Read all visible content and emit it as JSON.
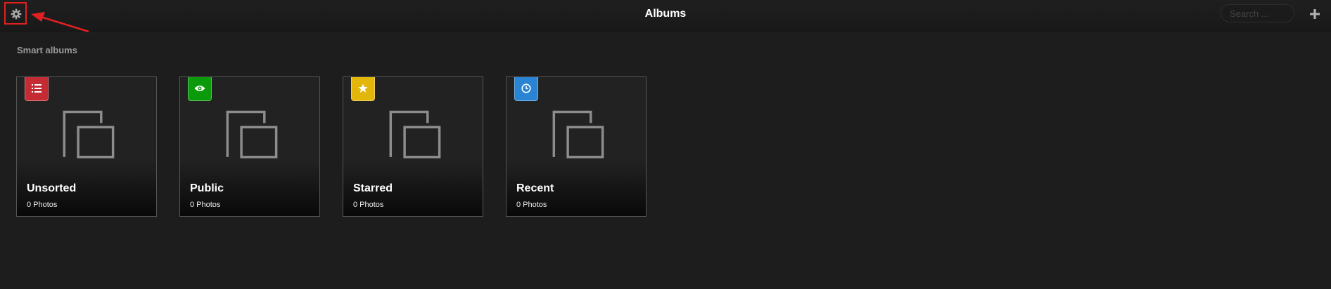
{
  "header": {
    "title": "Albums",
    "search_placeholder": "Search ..."
  },
  "section": {
    "title": "Smart albums"
  },
  "albums": [
    {
      "name": "Unsorted",
      "count": "0 Photos",
      "badge_color": "#c42b33",
      "badge_icon": "list-icon"
    },
    {
      "name": "Public",
      "count": "0 Photos",
      "badge_color": "#0a9a0a",
      "badge_icon": "eye-icon"
    },
    {
      "name": "Starred",
      "count": "0 Photos",
      "badge_color": "#e3b60a",
      "badge_icon": "star-icon"
    },
    {
      "name": "Recent",
      "count": "0 Photos",
      "badge_color": "#2a84d4",
      "badge_icon": "clock-icon"
    }
  ],
  "colors": {
    "background": "#1d1d1d",
    "annotation": "#e02020"
  }
}
